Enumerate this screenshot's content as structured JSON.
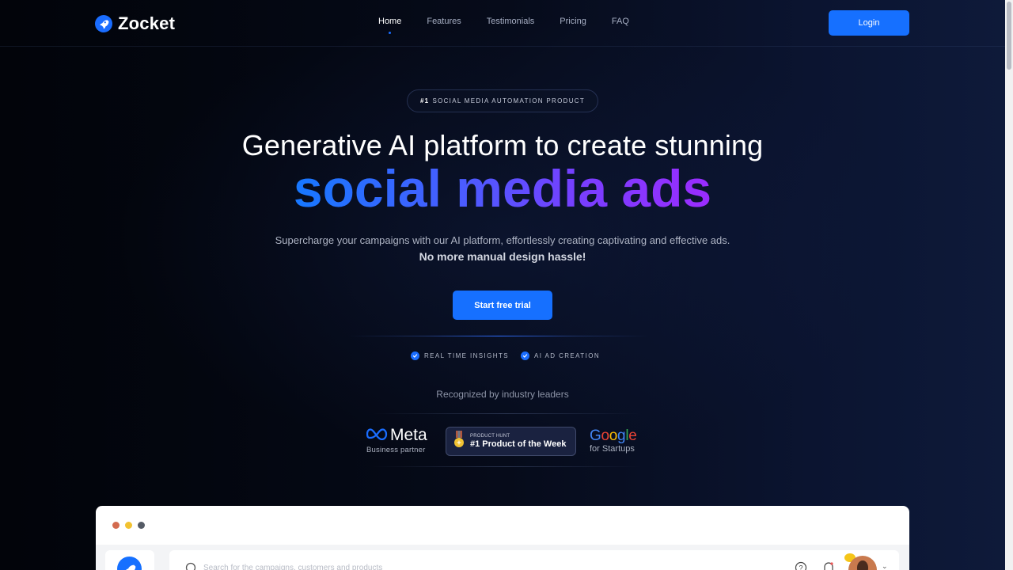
{
  "nav": {
    "brand": "Zocket",
    "links": [
      {
        "label": "Home",
        "active": true
      },
      {
        "label": "Features",
        "active": false
      },
      {
        "label": "Testimonials",
        "active": false
      },
      {
        "label": "Pricing",
        "active": false
      },
      {
        "label": "FAQ",
        "active": false
      }
    ],
    "login_label": "Login"
  },
  "hero": {
    "pill_rank": "#1",
    "pill_text": "SOCIAL MEDIA AUTOMATION PRODUCT",
    "headline": "Generative AI platform to create stunning",
    "headline_accent": "social media ads",
    "subtitle": "Supercharge your campaigns with our AI platform, effortlessly creating captivating and effective ads.",
    "subtitle_bold": "No more manual design hassle!",
    "cta_label": "Start free trial",
    "features": [
      {
        "icon": "check-circle-icon",
        "label": "REAL TIME INSIGHTS"
      },
      {
        "icon": "check-circle-icon",
        "label": "AI AD CREATION"
      }
    ],
    "recognized_label": "Recognized by industry leaders",
    "partners": {
      "meta": {
        "name": "Meta",
        "subtitle": "Business partner"
      },
      "product_hunt": {
        "small": "PRODUCT HUNT",
        "big": "#1 Product of the Week"
      },
      "google": {
        "name_letters": [
          "G",
          "o",
          "o",
          "g",
          "l",
          "e"
        ],
        "subtitle": "for Startups"
      }
    }
  },
  "preview": {
    "window_dots": [
      "#d36b4f",
      "#f2c230",
      "#555b66"
    ],
    "search_placeholder": "Search for the campaigns, customers and products"
  },
  "colors": {
    "accent": "#1670ff",
    "gradient_start": "#1678ff",
    "gradient_end": "#9b2cff"
  }
}
